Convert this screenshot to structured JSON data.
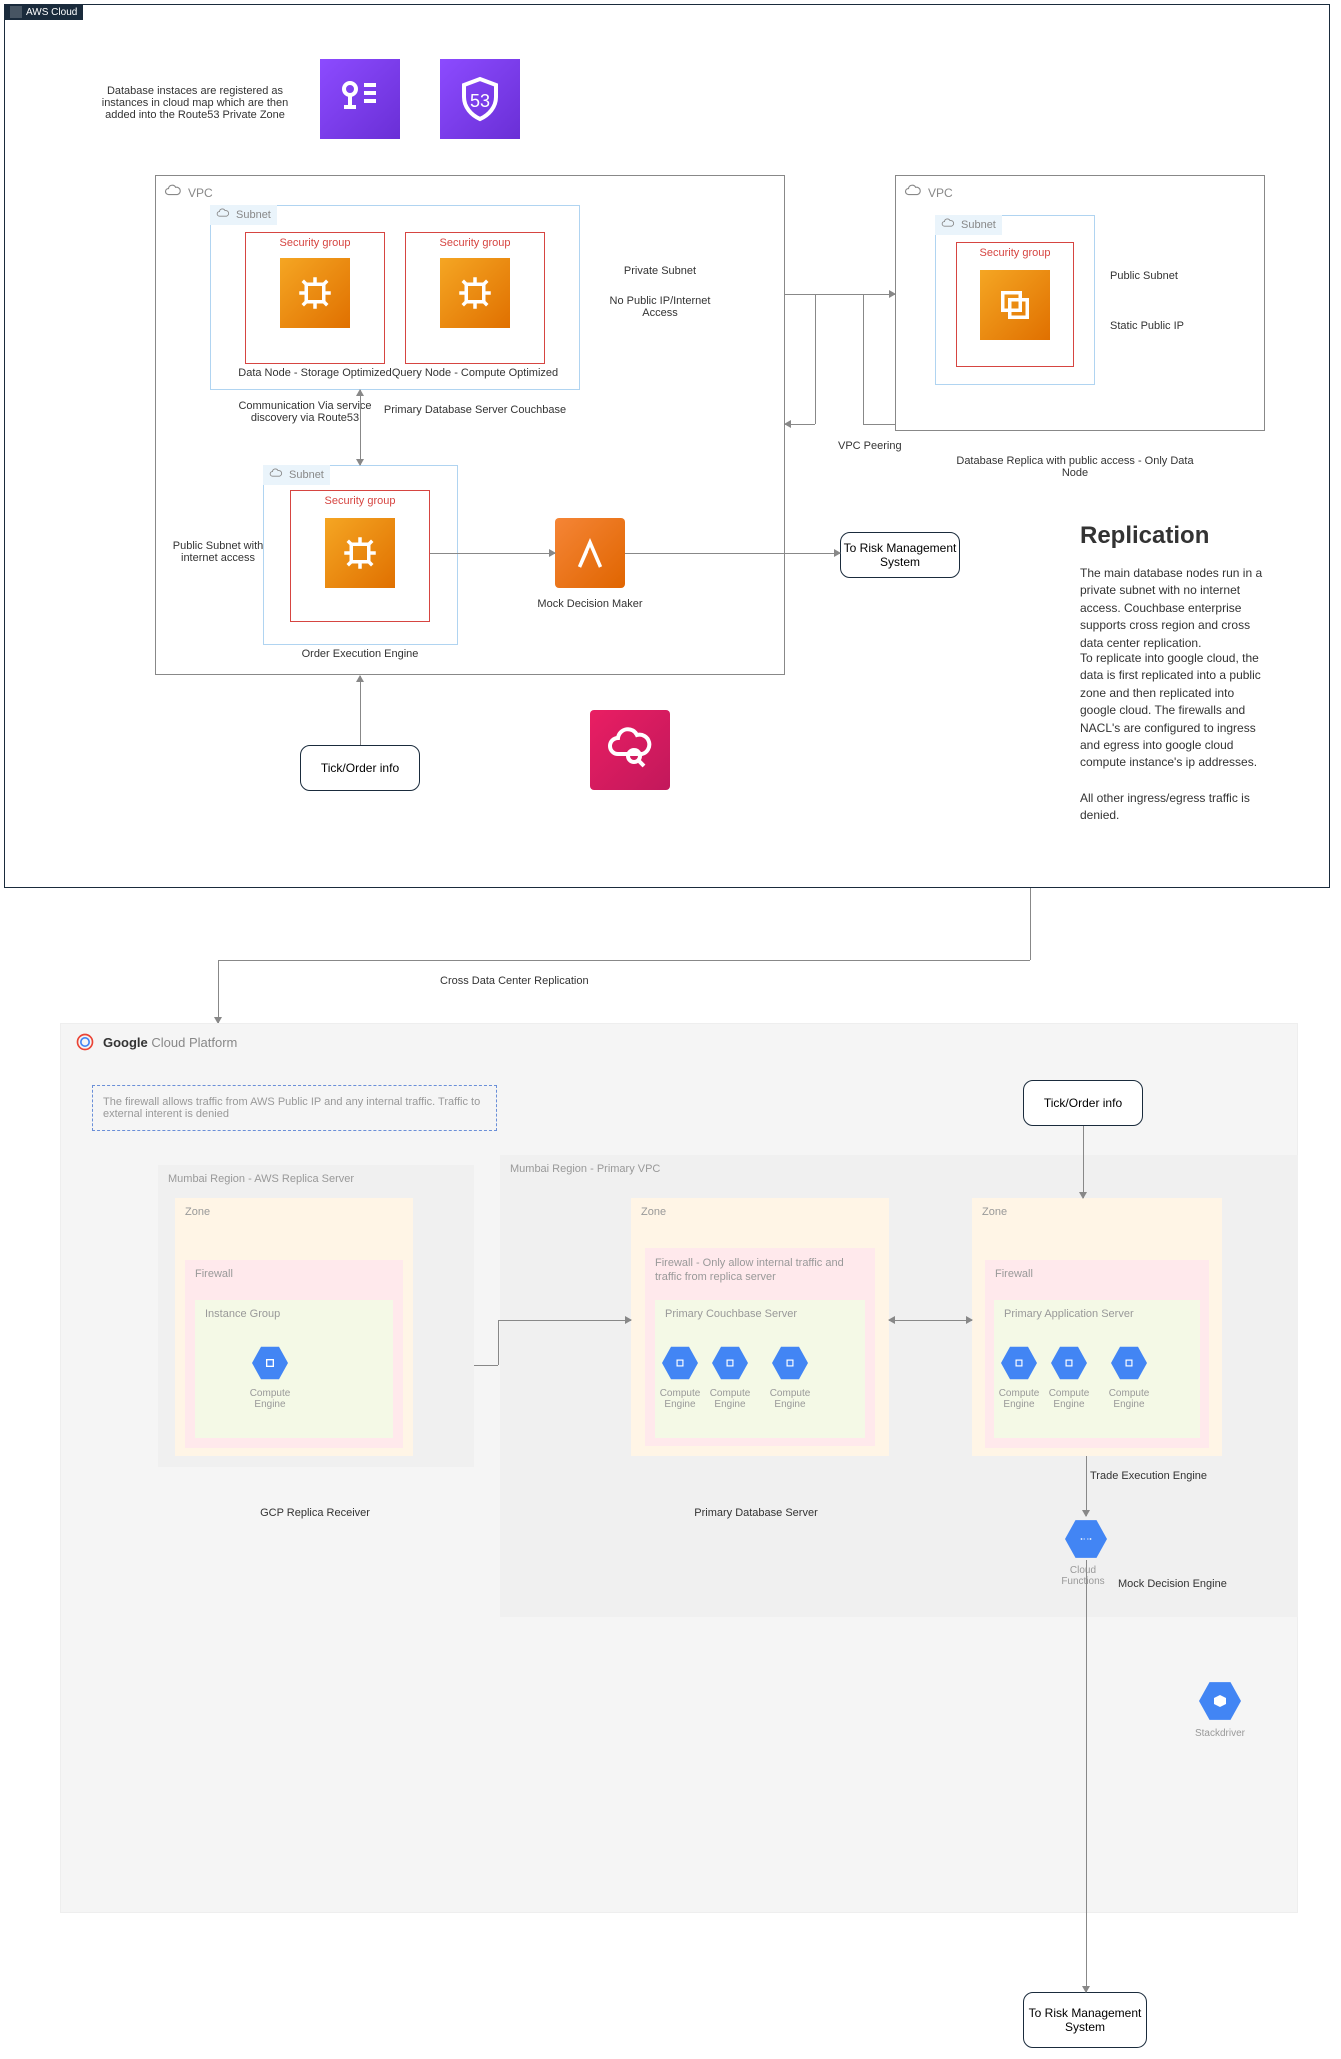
{
  "aws": {
    "cloud_label": "AWS Cloud",
    "note_cloudmap": "Database instaces are registered as instances in cloud map which are then added into the Route53 Private Zone",
    "vpc1": {
      "label": "VPC",
      "subnet1_label": "Subnet",
      "sg_label": "Security group",
      "data_node": "Data Node - Storage Optimized",
      "query_node": "Query Node - Compute Optimized",
      "comm_note": "Communication Via service discovery via Route53",
      "primary_db": "Primary Database Server Couchbase",
      "private_subnet": "Private Subnet",
      "no_public": "No Public IP/Internet Access",
      "subnet2_label": "Subnet",
      "public_subnet": "Public Subnet with internet access",
      "order_exec": "Order Execution Engine",
      "mock_decision": "Mock Decision Maker"
    },
    "vpc2": {
      "label": "VPC",
      "subnet_label": "Subnet",
      "sg_label": "Security group",
      "public_subnet": "Public Subnet",
      "static_ip": "Static Public IP",
      "replica_desc": "Database Replica with public access - Only Data Node"
    },
    "vpc_peering": "VPC Peering",
    "to_risk": "To Risk Management System",
    "tick_order": "Tick/Order info",
    "replication": {
      "title": "Replication",
      "p1": "The main database nodes run in a private subnet with no internet access. Couchbase enterprise supports cross region and cross data center replication.",
      "p2": "To replicate into google cloud, the data is first replicated into a public zone and then replicated into google cloud. The firewalls and NACL's are configured to ingress and egress into google cloud compute instance's ip addresses.",
      "p3": "All other ingress/egress traffic is denied."
    },
    "cross_dc": "Cross Data Center Replication"
  },
  "gcp": {
    "platform_google": "Google",
    "platform_cloud": " Cloud Platform",
    "firewall_note": "The firewall allows traffic from AWS Public IP and any internal traffic. Traffic to external interent is denied",
    "replica_region": "Mumbai Region - AWS Replica Server",
    "primary_region": "Mumbai Region - Primary VPC",
    "zone": "Zone",
    "firewall": "Firewall",
    "firewall_primary_note": "Firewall - Only allow internal traffic and traffic from replica server",
    "instance_group": "Instance Group",
    "compute_engine": "Compute Engine",
    "primary_cb": "Primary Couchbase Server",
    "primary_app": "Primary Application Server",
    "gcp_replica_rx": "GCP Replica Receiver",
    "primary_db_server": "Primary Database Server",
    "trade_exec": "Trade Execution Engine",
    "cloud_functions": "Cloud Functions",
    "mock_decision": "Mock Decision Engine",
    "stackdriver": "Stackdriver",
    "tick_order": "Tick/Order info",
    "to_risk": "To Risk Management System"
  }
}
